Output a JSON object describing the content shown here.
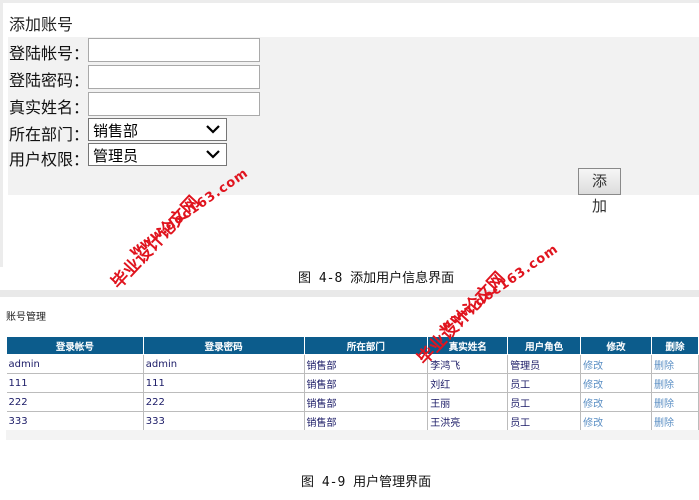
{
  "add_form": {
    "title": "添加账号",
    "fields": [
      {
        "label": "登陆帐号：",
        "value": ""
      },
      {
        "label": "登陆密码：",
        "value": ""
      },
      {
        "label": "真实姓名：",
        "value": ""
      }
    ],
    "department": {
      "label": "所在部门：",
      "selected": "销售部"
    },
    "permission": {
      "label": "用户权限：",
      "selected": "管理员"
    },
    "submit_label": "添 加"
  },
  "caption_4_8": "图 4-8  添加用户信息界面",
  "user_table": {
    "title": "账号管理",
    "headers": [
      "登录帐号",
      "登录密码",
      "所在部门",
      "真实姓名",
      "用户角色",
      "修改",
      "删除"
    ],
    "rows": [
      [
        "admin",
        "admin",
        "销售部",
        "李鸿飞",
        "管理员",
        "修改",
        "删除"
      ],
      [
        "111",
        "111",
        "销售部",
        "刘红",
        "员工",
        "修改",
        "删除"
      ],
      [
        "222",
        "222",
        "销售部",
        "王丽",
        "员工",
        "修改",
        "删除"
      ],
      [
        "333",
        "333",
        "销售部",
        "王洪亮",
        "员工",
        "修改",
        "删除"
      ]
    ]
  },
  "caption_4_9": "图 4-9   用户管理界面",
  "watermark": {
    "brand": "毕业设计论文网",
    "url": "www.doc163.com",
    "color": "#e0141e"
  }
}
